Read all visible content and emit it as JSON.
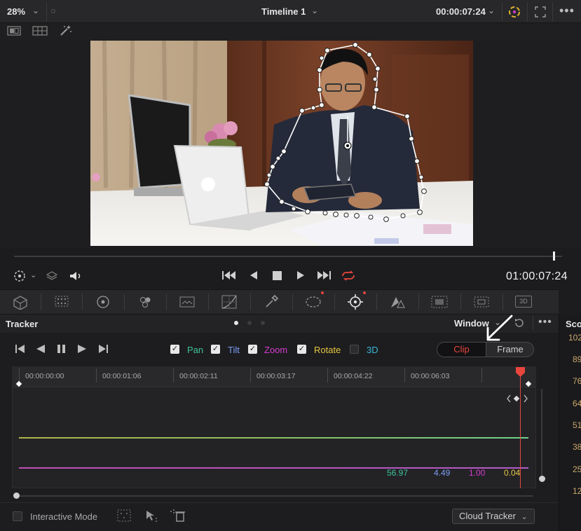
{
  "viewer": {
    "zoom": "28%",
    "timeline_name": "Timeline 1",
    "timecode_top": "00:00:07:24",
    "timecode_main": "01:00:07:24"
  },
  "tracker": {
    "title": "Tracker",
    "window_dropdown": "Window",
    "checkboxes": [
      {
        "label": "Pan",
        "checked": true,
        "color": "#3ec49a"
      },
      {
        "label": "Tilt",
        "checked": true,
        "color": "#7b9cf5"
      },
      {
        "label": "Zoom",
        "checked": true,
        "color": "#d83bd0"
      },
      {
        "label": "Rotate",
        "checked": true,
        "color": "#e5c642"
      },
      {
        "label": "3D",
        "checked": false,
        "color": "#38b8d8"
      }
    ],
    "segment": {
      "clip": "Clip",
      "frame": "Frame",
      "active": "Clip"
    },
    "ruler_timecodes": [
      "00:00:00:00",
      "00:00:01:06",
      "00:00:02:11",
      "00:00:03:17",
      "00:00:04:22",
      "00:00:06:03"
    ],
    "values": [
      {
        "text": "56.97",
        "color": "#3ec49a"
      },
      {
        "text": "4.49",
        "color": "#7b9cf5"
      },
      {
        "text": "1.00",
        "color": "#d83bd0"
      },
      {
        "text": "0.04",
        "color": "#e5c642"
      }
    ],
    "interactive_mode_label": "Interactive Mode",
    "cloud_tracker_label": "Cloud Tracker"
  },
  "scopes": {
    "title": "Sco",
    "values": [
      "102",
      "89",
      "76",
      "64",
      "51",
      "38",
      "25",
      "12"
    ]
  },
  "colors": {
    "accent_red": "#e8453c",
    "panel_bg": "#1d1d1f"
  }
}
